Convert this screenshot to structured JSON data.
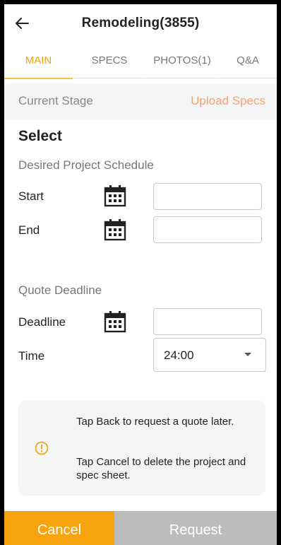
{
  "header": {
    "title": "Remodeling(3855)",
    "back_icon": "arrow-left-icon"
  },
  "tabs": [
    {
      "label": "MAIN",
      "active": true
    },
    {
      "label": "SPECS",
      "active": false
    },
    {
      "label": "PHOTOS(1)",
      "active": false
    },
    {
      "label": "Q&A",
      "active": false
    }
  ],
  "stage": {
    "label": "Current Stage",
    "upload_link": "Upload Specs"
  },
  "schedule": {
    "section_title": "Select",
    "subheading": "Desired Project Schedule",
    "start_label": "Start",
    "start_value": "",
    "end_label": "End",
    "end_value": ""
  },
  "quote": {
    "subheading": "Quote Deadline",
    "deadline_label": "Deadline",
    "deadline_value": "",
    "time_label": "Time",
    "time_value": "24:00"
  },
  "notice": {
    "icon": "info-circle-icon",
    "line1": "Tap Back to request a quote later.",
    "line2": "Tap Cancel to delete the project and spec sheet."
  },
  "footer": {
    "cancel_label": "Cancel",
    "request_label": "Request"
  },
  "colors": {
    "accent": "#f7a30e",
    "tab_active": "#f2a516",
    "upload_link": "#f7a174",
    "disabled": "#bcbcbc"
  }
}
